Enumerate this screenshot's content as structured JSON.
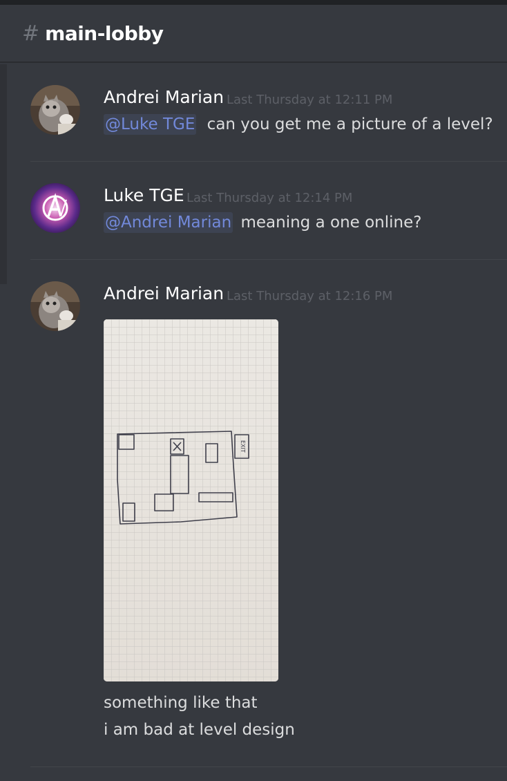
{
  "channel": {
    "hash": "#",
    "name": "main-lobby"
  },
  "messages": [
    {
      "author": "Andrei Marian",
      "timestamp": "Last Thursday at 12:11 PM",
      "mention": "@Luke TGE",
      "text": "can you get me a picture of a level?",
      "avatar_icon": "cat-avatar"
    },
    {
      "author": "Luke TGE",
      "timestamp": "Last Thursday at 12:14 PM",
      "mention": "@Andrei Marian",
      "text": "meaning a one online?",
      "avatar_icon": "avengers-logo-avatar"
    },
    {
      "author": "Andrei Marian",
      "timestamp": "Last Thursday at 12:16 PM",
      "attachment": {
        "type": "photo",
        "description_icon": "level-sketch-photo",
        "sketch_text": "EXIT"
      },
      "lines": [
        "something like that",
        "i am bad at level design"
      ],
      "avatar_icon": "cat-avatar"
    }
  ],
  "colors": {
    "background": "#36393f",
    "mention": "#7289da",
    "timestamp": "#5d6067",
    "text": "#dcddde"
  }
}
